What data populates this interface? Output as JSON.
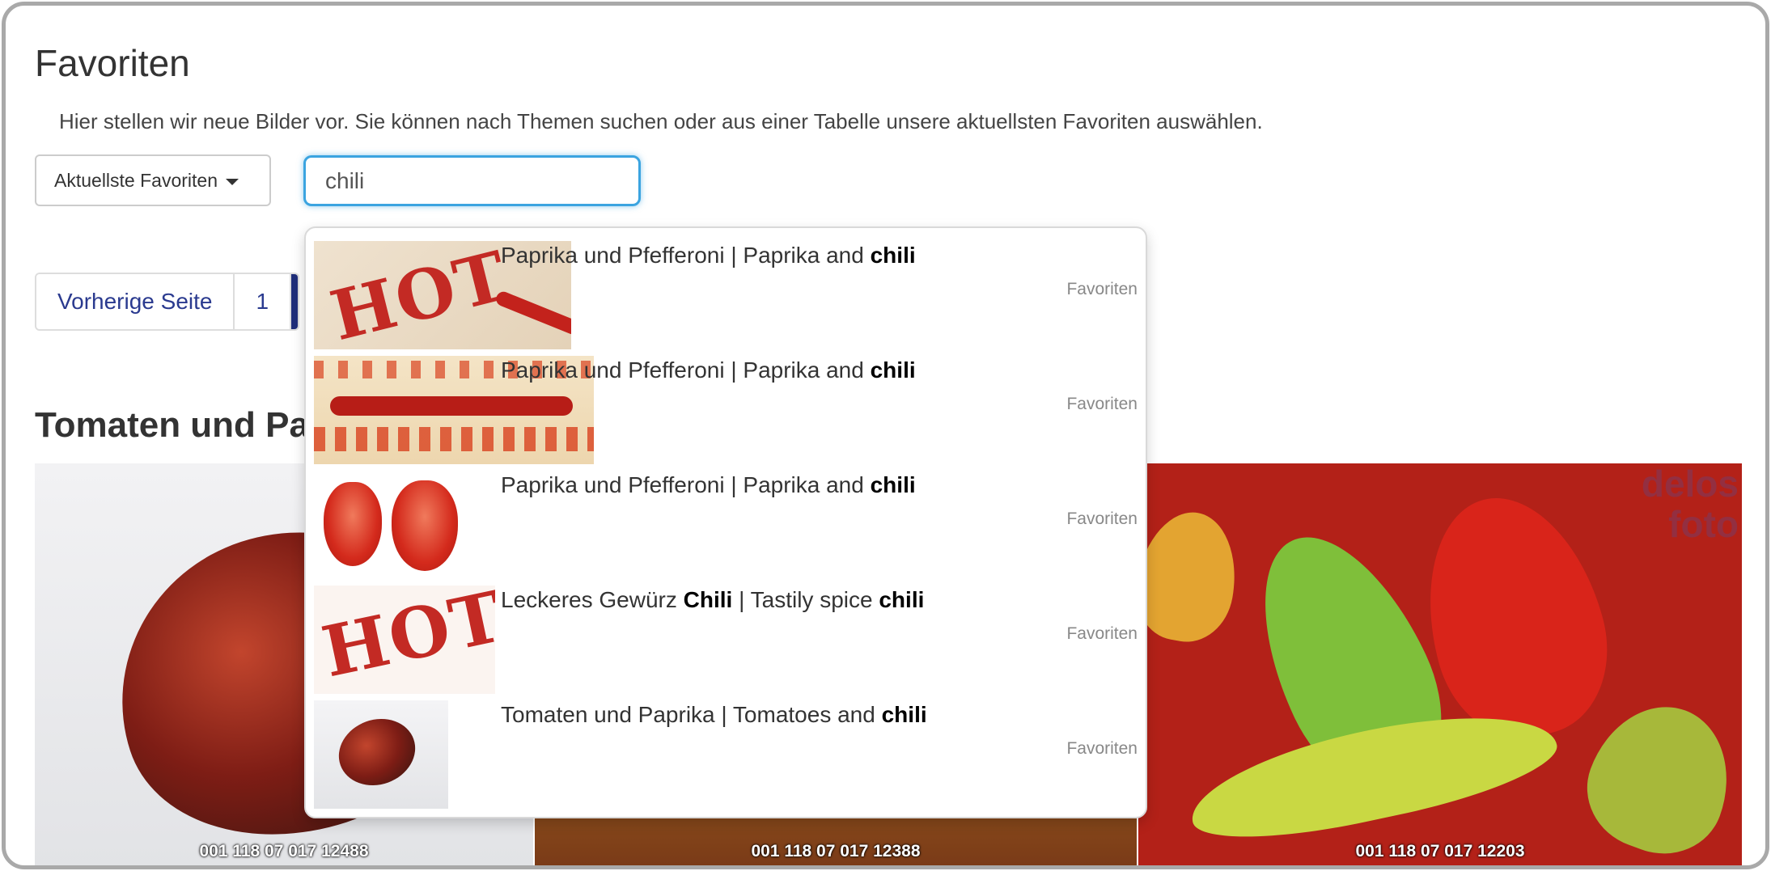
{
  "header": {
    "title": "Favoriten",
    "intro": "Hier stellen wir neue Bilder vor. Sie können nach Themen suchen oder aus einer Tabelle unsere aktuellsten Favoriten auswählen."
  },
  "filter": {
    "dropdown_label": "Aktuellste Favoriten"
  },
  "search": {
    "value": "chili"
  },
  "pager": {
    "prev_label": "Vorherige Seite",
    "page_1": "1"
  },
  "section": {
    "title": "Tomaten und Paprika"
  },
  "gallery": {
    "images": [
      {
        "code": "001 118 07 017 12488"
      },
      {
        "code": "001 118 07 017 12388"
      },
      {
        "code": "001 118 07 017 12203",
        "brand_line1": "delos",
        "brand_line2": "foto"
      }
    ]
  },
  "suggestions": [
    {
      "prefix": "Paprika und Pfefferoni | Paprika and ",
      "bold1": "chili",
      "middle": "",
      "bold2": "",
      "category": "Favoriten",
      "thumb_text": "HOT"
    },
    {
      "prefix": "Paprika und Pfefferoni | Paprika and ",
      "bold1": "chili",
      "middle": "",
      "bold2": "",
      "category": "Favoriten",
      "thumb_text": ""
    },
    {
      "prefix": "Paprika und Pfefferoni | Paprika and ",
      "bold1": "chili",
      "middle": "",
      "bold2": "",
      "category": "Favoriten",
      "thumb_text": ""
    },
    {
      "prefix": "Leckeres Gewürz ",
      "bold1": "Chili",
      "middle": " | Tastily spice ",
      "bold2": "chili",
      "category": "Favoriten",
      "thumb_text": "HOT"
    },
    {
      "prefix": "Tomaten und Paprika | Tomatoes and ",
      "bold1": "chili",
      "middle": "",
      "bold2": "",
      "category": "Favoriten",
      "thumb_text": ""
    }
  ],
  "colors": {
    "accent": "#3ba4e0",
    "link": "#2a3a8f",
    "pager_active": "#1f2e7a",
    "chili_red": "#c32a24"
  }
}
